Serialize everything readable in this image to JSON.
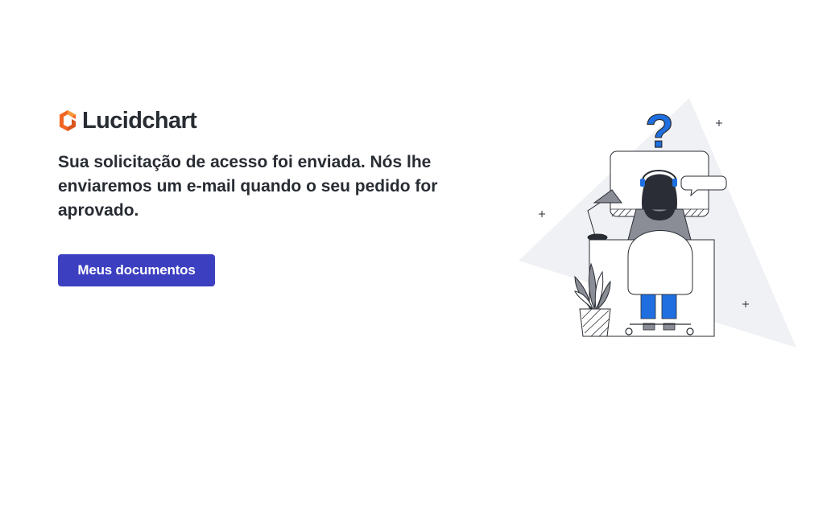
{
  "brand": {
    "name": "Lucidchart",
    "colors": {
      "orange": "#f26522",
      "text": "#282c33"
    }
  },
  "message": "Sua solicitação de acesso foi enviada. Nós lhe enviaremos um e-mail quando o seu pedido for aprovado.",
  "primary_button": {
    "label": "Meus documentos",
    "color": "#3b3fc0"
  },
  "illustration": {
    "icon": "person-at-desk-question-illustration",
    "question_mark": "?"
  }
}
